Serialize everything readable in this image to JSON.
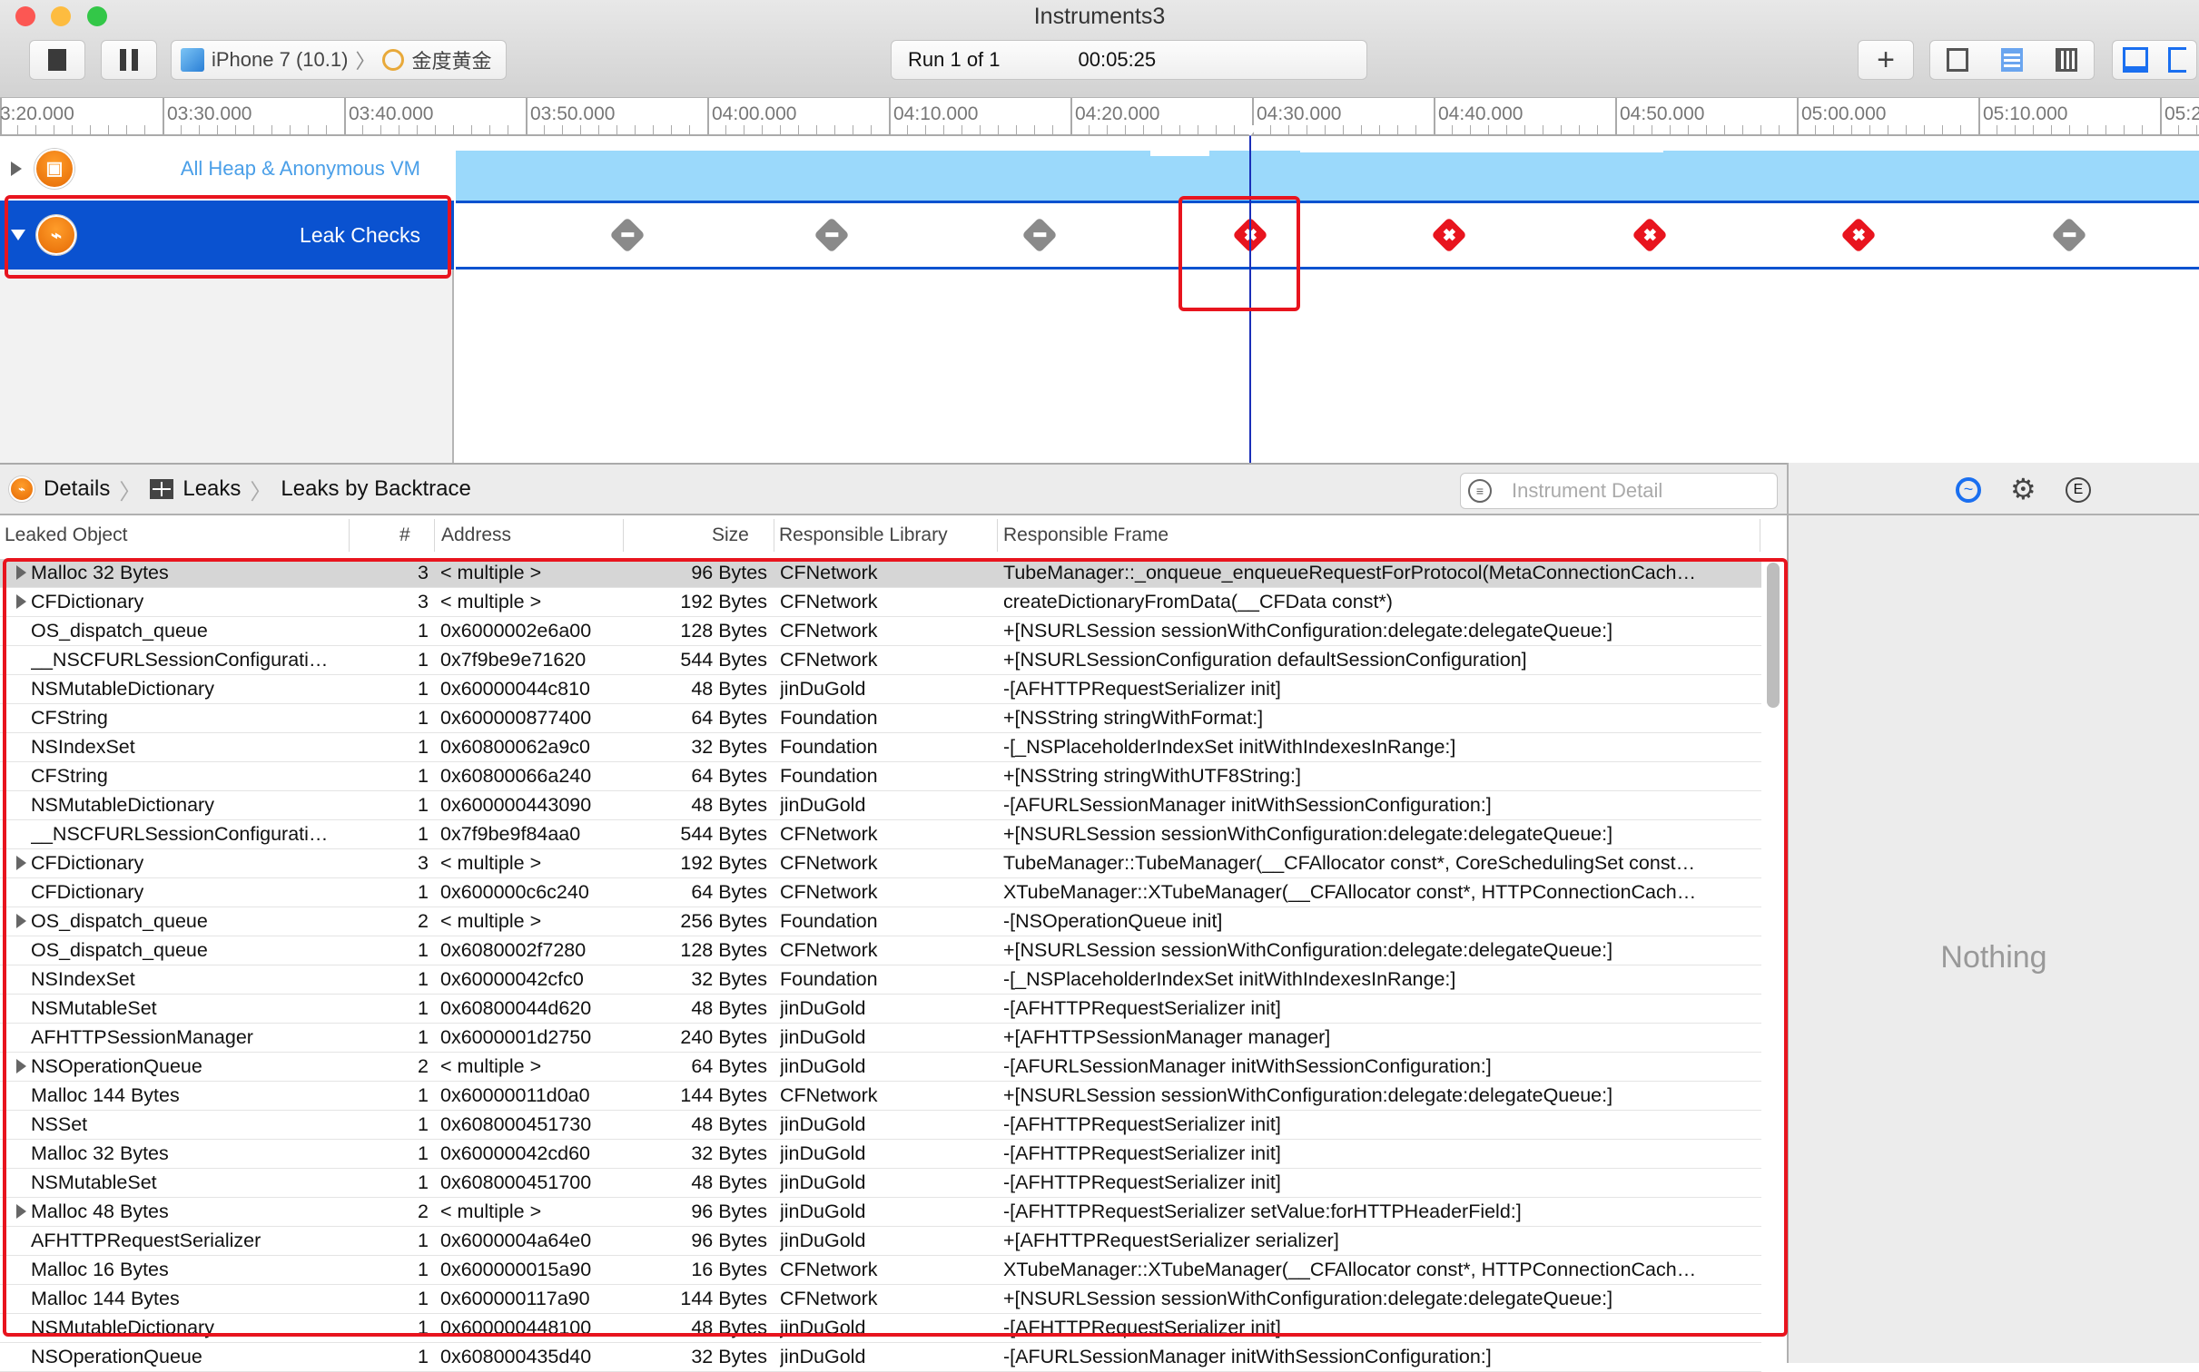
{
  "window": {
    "title": "Instruments3"
  },
  "toolbar": {
    "device": "iPhone 7 (10.1)",
    "separator": "〉",
    "app": "金度黄金",
    "run": "Run 1 of 1",
    "time": "00:05:25"
  },
  "ruler": {
    "labels": [
      "3:20.000",
      "03:30.000",
      "03:40.000",
      "03:50.000",
      "04:00.000",
      "04:10.000",
      "04:20.000",
      "04:30.000",
      "04:40.000",
      "04:50.000",
      "05:00.000",
      "05:10.000",
      "05:2"
    ]
  },
  "tracks": [
    {
      "label": "All Heap & Anonymous VM",
      "expanded": false
    },
    {
      "label": "Leak Checks",
      "expanded": true,
      "selected": true
    }
  ],
  "leak_markers": [
    "none",
    "none",
    "none",
    "leak",
    "leak",
    "leak",
    "leak",
    "none"
  ],
  "colors": {
    "selection": "#0a52d0",
    "leak": "#e8141e",
    "heap": "#9bd9fb",
    "highlight": "#e8141e"
  },
  "breadcrumb": [
    "Details",
    "Leaks",
    "Leaks by Backtrace"
  ],
  "filter": {
    "placeholder": "Instrument Detail"
  },
  "inspector": {
    "empty": "Nothing",
    "icons": [
      "extended-detail-icon",
      "gear-icon",
      "e-icon"
    ]
  },
  "table": {
    "columns": [
      "Leaked Object",
      "#",
      "Address",
      "Size",
      "Responsible Library",
      "Responsible Frame"
    ],
    "rows": [
      [
        "Malloc 32 Bytes",
        "3",
        "< multiple >",
        "96 Bytes",
        "CFNetwork",
        "TubeManager::_onqueue_enqueueRequestForProtocol(MetaConnectionCach…",
        true
      ],
      [
        "CFDictionary",
        "3",
        "< multiple >",
        "192 Bytes",
        "CFNetwork",
        "createDictionaryFromData(__CFData const*)",
        true
      ],
      [
        "OS_dispatch_queue",
        "1",
        "0x6000002e6a00",
        "128 Bytes",
        "CFNetwork",
        "+[NSURLSession sessionWithConfiguration:delegate:delegateQueue:]",
        false
      ],
      [
        "__NSCFURLSessionConfigurati…",
        "1",
        "0x7f9be9e71620",
        "544 Bytes",
        "CFNetwork",
        "+[NSURLSessionConfiguration defaultSessionConfiguration]",
        false
      ],
      [
        "NSMutableDictionary",
        "1",
        "0x60000044c810",
        "48 Bytes",
        "jinDuGold",
        "-[AFHTTPRequestSerializer init]",
        false
      ],
      [
        "CFString",
        "1",
        "0x600000877400",
        "64 Bytes",
        "Foundation",
        "+[NSString stringWithFormat:]",
        false
      ],
      [
        "NSIndexSet",
        "1",
        "0x60800062a9c0",
        "32 Bytes",
        "Foundation",
        "-[_NSPlaceholderIndexSet initWithIndexesInRange:]",
        false
      ],
      [
        "CFString",
        "1",
        "0x60800066a240",
        "64 Bytes",
        "Foundation",
        "+[NSString stringWithUTF8String:]",
        false
      ],
      [
        "NSMutableDictionary",
        "1",
        "0x600000443090",
        "48 Bytes",
        "jinDuGold",
        "-[AFURLSessionManager initWithSessionConfiguration:]",
        false
      ],
      [
        "__NSCFURLSessionConfigurati…",
        "1",
        "0x7f9be9f84aa0",
        "544 Bytes",
        "CFNetwork",
        "+[NSURLSession sessionWithConfiguration:delegate:delegateQueue:]",
        false
      ],
      [
        "CFDictionary",
        "3",
        "< multiple >",
        "192 Bytes",
        "CFNetwork",
        "TubeManager::TubeManager(__CFAllocator const*, CoreSchedulingSet const…",
        true
      ],
      [
        "CFDictionary",
        "1",
        "0x600000c6c240",
        "64 Bytes",
        "CFNetwork",
        "XTubeManager::XTubeManager(__CFAllocator const*, HTTPConnectionCach…",
        false
      ],
      [
        "OS_dispatch_queue",
        "2",
        "< multiple >",
        "256 Bytes",
        "Foundation",
        "-[NSOperationQueue init]",
        true
      ],
      [
        "OS_dispatch_queue",
        "1",
        "0x6080002f7280",
        "128 Bytes",
        "CFNetwork",
        "+[NSURLSession sessionWithConfiguration:delegate:delegateQueue:]",
        false
      ],
      [
        "NSIndexSet",
        "1",
        "0x60000042cfc0",
        "32 Bytes",
        "Foundation",
        "-[_NSPlaceholderIndexSet initWithIndexesInRange:]",
        false
      ],
      [
        "NSMutableSet",
        "1",
        "0x60800044d620",
        "48 Bytes",
        "jinDuGold",
        "-[AFHTTPRequestSerializer init]",
        false
      ],
      [
        "AFHTTPSessionManager",
        "1",
        "0x6000001d2750",
        "240 Bytes",
        "jinDuGold",
        "+[AFHTTPSessionManager manager]",
        false
      ],
      [
        "NSOperationQueue",
        "2",
        "< multiple >",
        "64 Bytes",
        "jinDuGold",
        "-[AFURLSessionManager initWithSessionConfiguration:]",
        true
      ],
      [
        "Malloc 144 Bytes",
        "1",
        "0x60000011d0a0",
        "144 Bytes",
        "CFNetwork",
        "+[NSURLSession sessionWithConfiguration:delegate:delegateQueue:]",
        false
      ],
      [
        "NSSet",
        "1",
        "0x608000451730",
        "48 Bytes",
        "jinDuGold",
        "-[AFHTTPRequestSerializer init]",
        false
      ],
      [
        "Malloc 32 Bytes",
        "1",
        "0x60000042cd60",
        "32 Bytes",
        "jinDuGold",
        "-[AFHTTPRequestSerializer init]",
        false
      ],
      [
        "NSMutableSet",
        "1",
        "0x608000451700",
        "48 Bytes",
        "jinDuGold",
        "-[AFHTTPRequestSerializer init]",
        false
      ],
      [
        "Malloc 48 Bytes",
        "2",
        "< multiple >",
        "96 Bytes",
        "jinDuGold",
        "-[AFHTTPRequestSerializer setValue:forHTTPHeaderField:]",
        true
      ],
      [
        "AFHTTPRequestSerializer",
        "1",
        "0x6000004a64e0",
        "96 Bytes",
        "jinDuGold",
        "+[AFHTTPRequestSerializer serializer]",
        false
      ],
      [
        "Malloc 16 Bytes",
        "1",
        "0x600000015a90",
        "16 Bytes",
        "CFNetwork",
        "XTubeManager::XTubeManager(__CFAllocator const*, HTTPConnectionCach…",
        false
      ],
      [
        "Malloc 144 Bytes",
        "1",
        "0x600000117a90",
        "144 Bytes",
        "CFNetwork",
        "+[NSURLSession sessionWithConfiguration:delegate:delegateQueue:]",
        false
      ],
      [
        "NSMutableDictionary",
        "1",
        "0x600000448100",
        "48 Bytes",
        "jinDuGold",
        "-[AFHTTPRequestSerializer init]",
        false
      ],
      [
        "NSOperationQueue",
        "1",
        "0x608000435d40",
        "32 Bytes",
        "jinDuGold",
        "-[AFURLSessionManager initWithSessionConfiguration:]",
        false
      ]
    ]
  }
}
